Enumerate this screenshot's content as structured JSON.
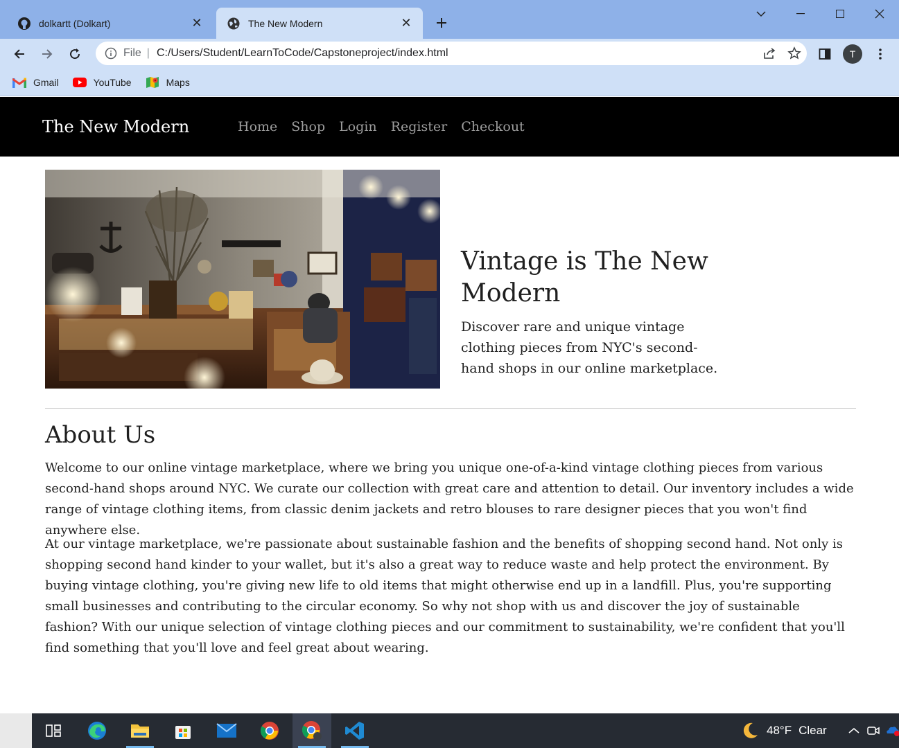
{
  "browser": {
    "tabs": [
      {
        "title": "dolkartt (Dolkart)",
        "icon": "github-icon",
        "active": false
      },
      {
        "title": "The New Modern",
        "icon": "globe-icon",
        "active": true
      }
    ],
    "address_bar": {
      "scheme_label": "File",
      "url": "C:/Users/Student/LearnToCode/Capstoneproject/index.html"
    },
    "profile_initial": "T",
    "bookmarks": [
      {
        "label": "Gmail",
        "icon": "gmail-icon"
      },
      {
        "label": "YouTube",
        "icon": "youtube-icon"
      },
      {
        "label": "Maps",
        "icon": "maps-icon"
      }
    ]
  },
  "site": {
    "brand": "The New Modern",
    "nav": [
      "Home",
      "Shop",
      "Login",
      "Register",
      "Checkout"
    ],
    "hero": {
      "title": "Vintage is The New Modern",
      "subtitle": "Discover rare and unique vintage clothing pieces from NYC's second-hand shops in our online marketplace."
    },
    "about": {
      "heading": "About Us",
      "p1": "Welcome to our online vintage marketplace, where we bring you unique one-of-a-kind vintage clothing pieces from various second-hand shops around NYC. We curate our collection with great care and attention to detail. Our inventory includes a wide range of vintage clothing items, from classic denim jackets and retro blouses to rare designer pieces that you won't find anywhere else.",
      "p2": "At our vintage marketplace, we're passionate about sustainable fashion and the benefits of shopping second hand. Not only is shopping second hand kinder to your wallet, but it's also a great way to reduce waste and help protect the environment. By buying vintage clothing, you're giving new life to old items that might otherwise end up in a landfill. Plus, you're supporting small businesses and contributing to the circular economy. So why not shop with us and discover the joy of sustainable fashion? With our unique selection of vintage clothing pieces and our commitment to sustainability, we're confident that you'll find something that you'll love and feel great about wearing."
    }
  },
  "taskbar": {
    "apps": [
      "task-view-icon",
      "edge-icon",
      "file-explorer-icon",
      "store-icon",
      "mail-icon",
      "chrome-icon",
      "chrome-profile-icon",
      "vscode-icon"
    ],
    "weather": {
      "temp": "48°F",
      "condition": "Clear"
    }
  },
  "colors": {
    "tabstrip": "#8eb1e8",
    "toolbar": "#cfe0f7",
    "site_nav_bg": "#000000",
    "nav_link": "#9d9d9d",
    "taskbar": "#262b33"
  }
}
